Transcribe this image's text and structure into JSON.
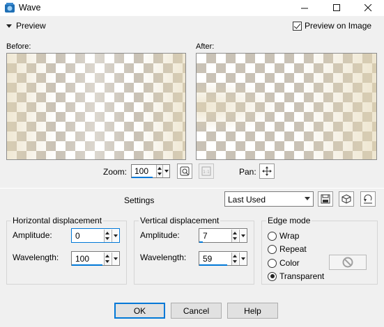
{
  "window": {
    "title": "Wave",
    "minimize_icon": "minimize-icon",
    "maximize_icon": "maximize-icon",
    "close_icon": "close-icon"
  },
  "preview": {
    "toggle_label": "Preview",
    "on_image_label": "Preview on Image",
    "on_image_checked": true,
    "before_label": "Before:",
    "after_label": "After:"
  },
  "zoom": {
    "label": "Zoom:",
    "value": "100",
    "pan_label": "Pan:"
  },
  "settings": {
    "label": "Settings",
    "preset": "Last Used"
  },
  "horizontal": {
    "title": "Horizontal displacement",
    "amplitude_label": "Amplitude:",
    "amplitude_value": "0",
    "wavelength_label": "Wavelength:",
    "wavelength_value": "100"
  },
  "vertical": {
    "title": "Vertical displacement",
    "amplitude_label": "Amplitude:",
    "amplitude_value": "7",
    "wavelength_label": "Wavelength:",
    "wavelength_value": "59"
  },
  "edge_mode": {
    "title": "Edge mode",
    "options": [
      "Wrap",
      "Repeat",
      "Color",
      "Transparent"
    ],
    "selected": "Transparent"
  },
  "buttons": {
    "ok": "OK",
    "cancel": "Cancel",
    "help": "Help"
  },
  "colors": {
    "accent": "#0078d7",
    "checker_dark": "#c9c2b6",
    "checker_light": "#ffffff",
    "glow": "#e3d5b0"
  }
}
